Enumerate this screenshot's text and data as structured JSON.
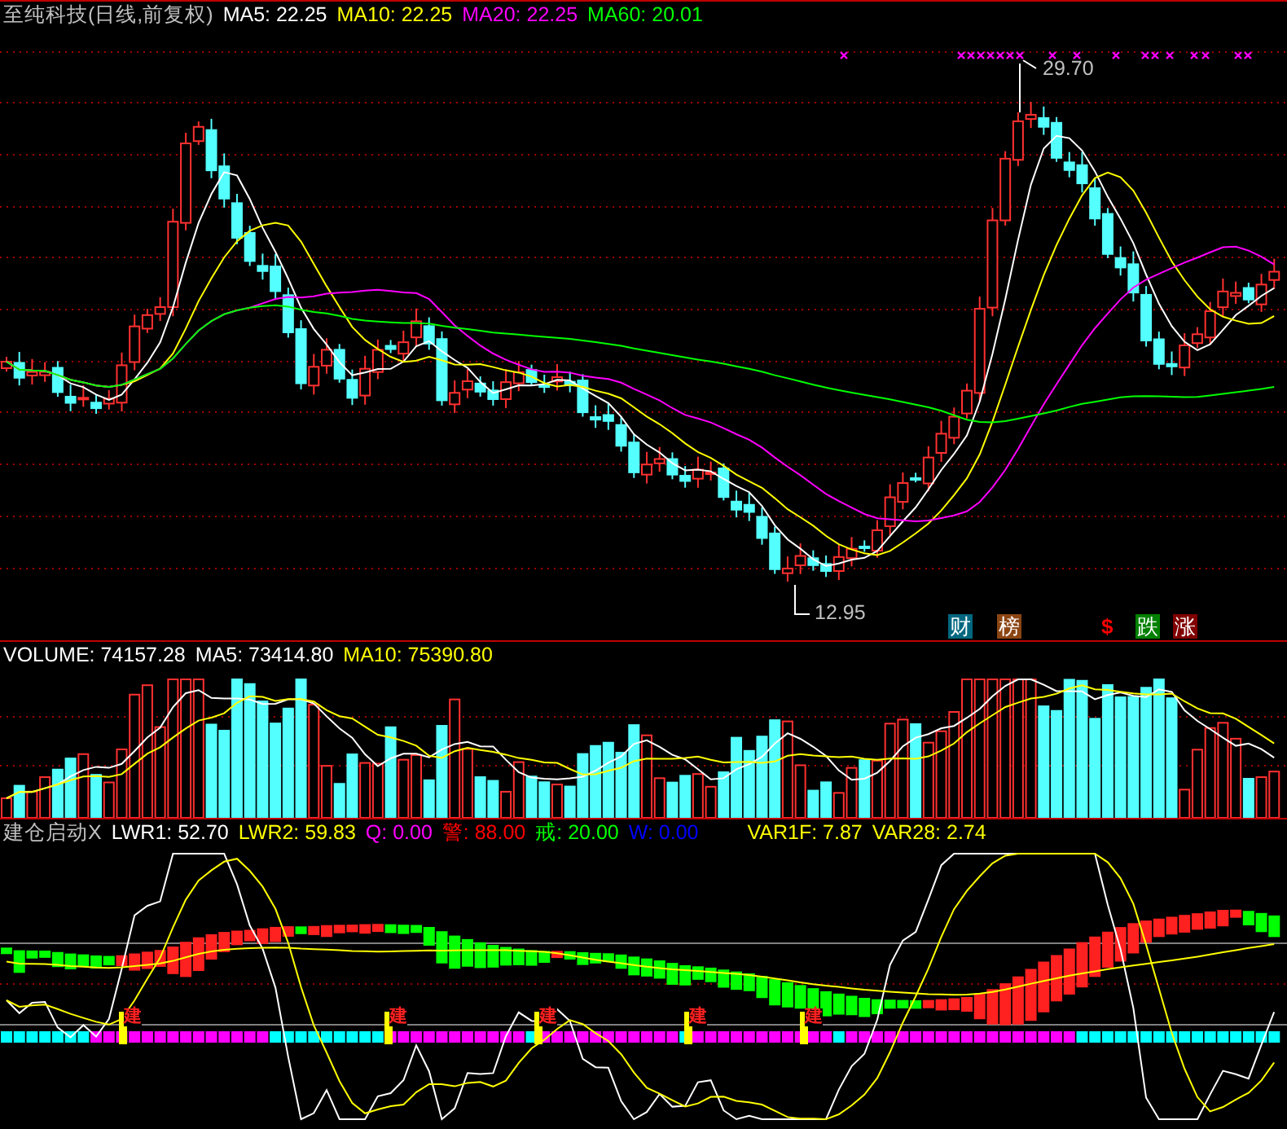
{
  "price_panel": {
    "legend": [
      {
        "text": "至纯科技(日线,前复权)",
        "color": "#c0c0c0"
      },
      {
        "text": "MA5: 22.25",
        "color": "#ffffff"
      },
      {
        "text": "MA10: 22.25",
        "color": "#ffff00"
      },
      {
        "text": "MA20: 22.25",
        "color": "#ff00ff"
      },
      {
        "text": "MA60: 20.01",
        "color": "#00ff00"
      }
    ],
    "high_label": "29.70",
    "low_label": "12.95",
    "signal_badges": [
      {
        "kind": "box",
        "text": "财",
        "color": "#00677f"
      },
      {
        "kind": "box",
        "text": "榜",
        "color": "#8b4513"
      },
      {
        "kind": "glyph",
        "text": "$",
        "color": "#ff0000"
      },
      {
        "kind": "box",
        "text": "跌",
        "color": "#008000"
      },
      {
        "kind": "box",
        "text": "涨",
        "color": "#800000"
      }
    ]
  },
  "volume_panel": {
    "legend": [
      {
        "text": "VOLUME: 74157.28",
        "color": "#ffffff"
      },
      {
        "text": "MA5: 73414.80",
        "color": "#ffffff"
      },
      {
        "text": "MA10: 75390.80",
        "color": "#ffff00"
      }
    ]
  },
  "indicator_panel": {
    "legend": [
      {
        "text": "建仓启动X",
        "color": "#c0c0c0"
      },
      {
        "text": "LWR1: 52.70",
        "color": "#ffffff"
      },
      {
        "text": "LWR2: 59.83",
        "color": "#ffff00"
      },
      {
        "text": "Q: 0.00",
        "color": "#ff00ff"
      },
      {
        "text": "警: 88.00",
        "color": "#ff0000"
      },
      {
        "text": "戒: 20.00",
        "color": "#00ff00"
      },
      {
        "text": "W: 0.00",
        "color": "#0000ff"
      },
      {
        "text": "VAR1F: 7.87",
        "color": "#ffff00"
      },
      {
        "text": "VAR28: 2.74",
        "color": "#ffff00"
      }
    ],
    "markers": [
      "建",
      "建",
      "建",
      "建",
      "建"
    ]
  }
}
